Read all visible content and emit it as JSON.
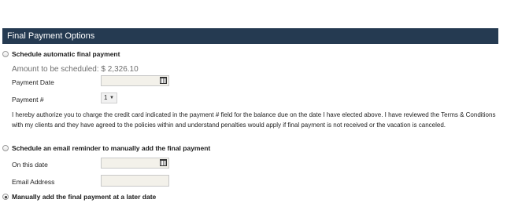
{
  "section": {
    "title": "Final Payment Options"
  },
  "automatic": {
    "radio_label": "Schedule automatic final payment",
    "amount_text": "Amount to be scheduled: $ 2,326.10",
    "payment_date_label": "Payment Date",
    "payment_date_value": "",
    "payment_num_label": "Payment #",
    "payment_num_selected": "1",
    "authorization_text": "I hereby authorize you to charge the credit card indicated in the payment # field for the balance due on the date I have elected above. I have reviewed the Terms & Conditions with my clients and they have agreed to the policies within and understand penalties would apply if final payment is not received or the vacation is canceled.",
    "checked": false
  },
  "email_reminder": {
    "radio_label": "Schedule an email reminder to manually add the final payment",
    "date_label": "On this date",
    "date_value": "",
    "email_label": "Email Address",
    "email_value": "",
    "checked": false
  },
  "manual": {
    "radio_label": "Manually add the final payment at a later date",
    "checked": true
  },
  "icons": {
    "calendar": "calendar-icon",
    "dropdown": "chevron-down-icon"
  },
  "colors": {
    "header_bg": "#253a51",
    "input_bg": "#f3f1ea"
  }
}
